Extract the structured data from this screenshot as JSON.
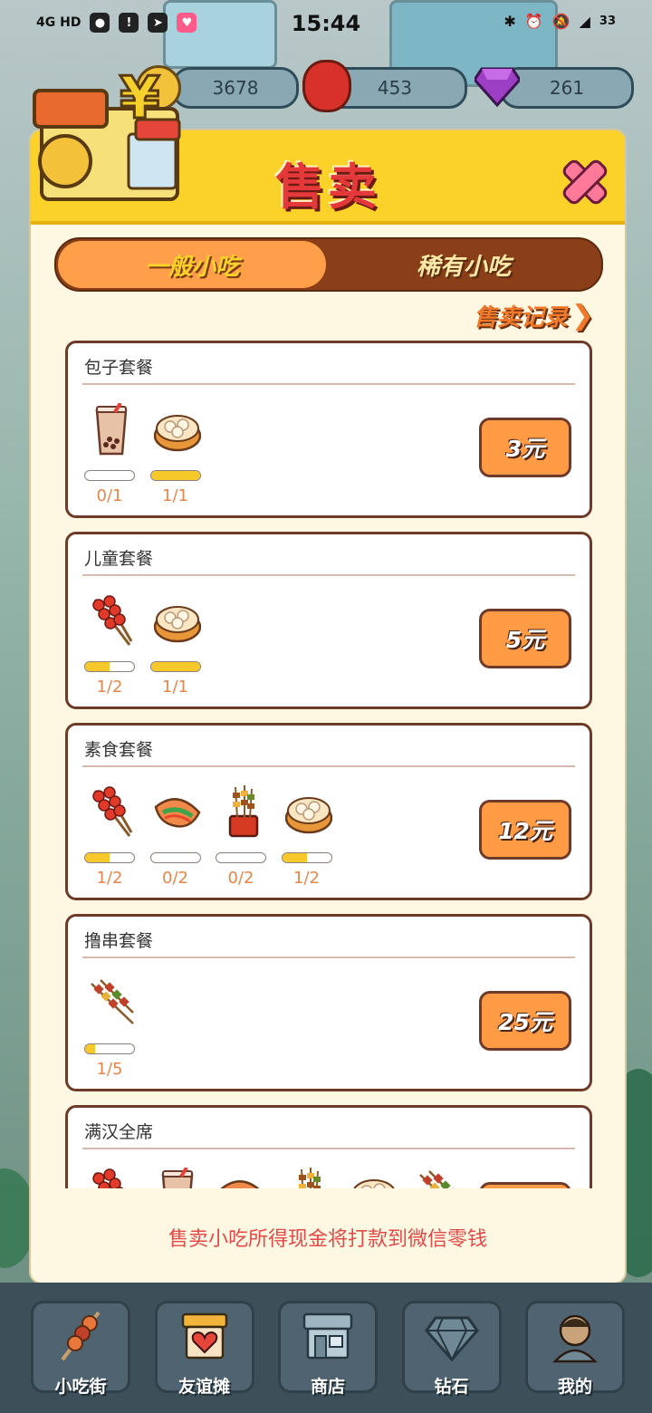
{
  "status_bar": {
    "network": "4G HD",
    "time": "15:44",
    "battery": "33"
  },
  "currency": {
    "coins": "3678",
    "lanterns": "453",
    "diamonds": "261"
  },
  "modal": {
    "title": "售卖",
    "tabs": [
      "一般小吃",
      "稀有小吃"
    ],
    "history_link": "售卖记录",
    "footer_note": "售卖小吃所得现金将打款到微信零钱"
  },
  "sets": [
    {
      "name": "包子套餐",
      "price": "3元",
      "items": [
        {
          "icon": "bubble-tea-icon",
          "count": "0/1",
          "progress": 0
        },
        {
          "icon": "steamed-buns-icon",
          "count": "1/1",
          "progress": 1
        }
      ]
    },
    {
      "name": "儿童套餐",
      "price": "5元",
      "items": [
        {
          "icon": "candied-haws-icon",
          "count": "1/2",
          "progress": 0.5
        },
        {
          "icon": "steamed-buns-icon",
          "count": "1/1",
          "progress": 1
        }
      ]
    },
    {
      "name": "素食套餐",
      "price": "12元",
      "items": [
        {
          "icon": "candied-haws-icon",
          "count": "1/2",
          "progress": 0.5
        },
        {
          "icon": "pancake-wrap-icon",
          "count": "0/2",
          "progress": 0
        },
        {
          "icon": "skewer-cup-icon",
          "count": "0/2",
          "progress": 0
        },
        {
          "icon": "steamed-buns-icon",
          "count": "1/2",
          "progress": 0.5
        }
      ]
    },
    {
      "name": "撸串套餐",
      "price": "25元",
      "items": [
        {
          "icon": "meat-skewer-icon",
          "count": "1/5",
          "progress": 0.2
        }
      ]
    },
    {
      "name": "满汉全席",
      "price": "",
      "items": [
        {
          "icon": "candied-haws-icon",
          "count": "",
          "progress": 0
        },
        {
          "icon": "bubble-tea-icon",
          "count": "",
          "progress": 0
        },
        {
          "icon": "pancake-wrap-icon",
          "count": "",
          "progress": 0
        },
        {
          "icon": "skewer-cup-icon",
          "count": "",
          "progress": 0
        },
        {
          "icon": "steamed-buns-icon",
          "count": "",
          "progress": 0
        },
        {
          "icon": "meat-skewer-icon",
          "count": "",
          "progress": 0
        }
      ]
    }
  ],
  "bottom_nav": [
    {
      "label": "小吃街",
      "icon": "skewer-nav-icon"
    },
    {
      "label": "友谊摊",
      "icon": "stall-heart-icon"
    },
    {
      "label": "商店",
      "icon": "store-icon"
    },
    {
      "label": "钻石",
      "icon": "diamond-icon"
    },
    {
      "label": "我的",
      "icon": "profile-icon"
    }
  ],
  "colors": {
    "accent": "#ff9a45",
    "header": "#fbd22a",
    "title": "#e5383b",
    "progress": "#f7c82a",
    "border": "#6e3b2a"
  }
}
